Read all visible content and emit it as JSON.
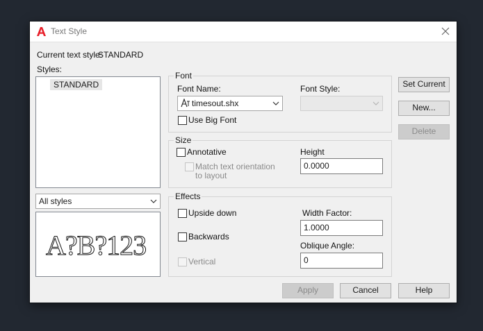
{
  "window": {
    "title": "Text Style",
    "icon": "autocad-a-icon",
    "colors": {
      "desktop": "#222831",
      "dialog": "#f0f0f0",
      "icon_red": "#e8202a"
    }
  },
  "current_style": {
    "label": "Current text style:",
    "value": "STANDARD"
  },
  "styles": {
    "label": "Styles:",
    "items": [
      "STANDARD"
    ],
    "filter_value": "All styles"
  },
  "preview": {
    "sample": "A?B?123"
  },
  "font": {
    "group_label": "Font",
    "name_label": "Font Name:",
    "name_value": "timesout.shx",
    "name_icon": "shx-font-icon",
    "style_label": "Font Style:",
    "style_value": "",
    "big_font_label": "Use Big Font",
    "big_font_checked": false
  },
  "size": {
    "group_label": "Size",
    "annotative_label": "Annotative",
    "annotative_checked": false,
    "match_label_line1": "Match text orientation",
    "match_label_line2": "to layout",
    "height_label": "Height",
    "height_value": "0.0000"
  },
  "effects": {
    "group_label": "Effects",
    "upside_down_label": "Upside down",
    "backwards_label": "Backwards",
    "vertical_label": "Vertical",
    "width_factor_label": "Width Factor:",
    "width_factor_value": "1.0000",
    "oblique_label": "Oblique Angle:",
    "oblique_value": "0"
  },
  "buttons": {
    "set_current": "Set Current",
    "new": "New...",
    "delete": "Delete",
    "apply": "Apply",
    "cancel": "Cancel",
    "help": "Help"
  }
}
